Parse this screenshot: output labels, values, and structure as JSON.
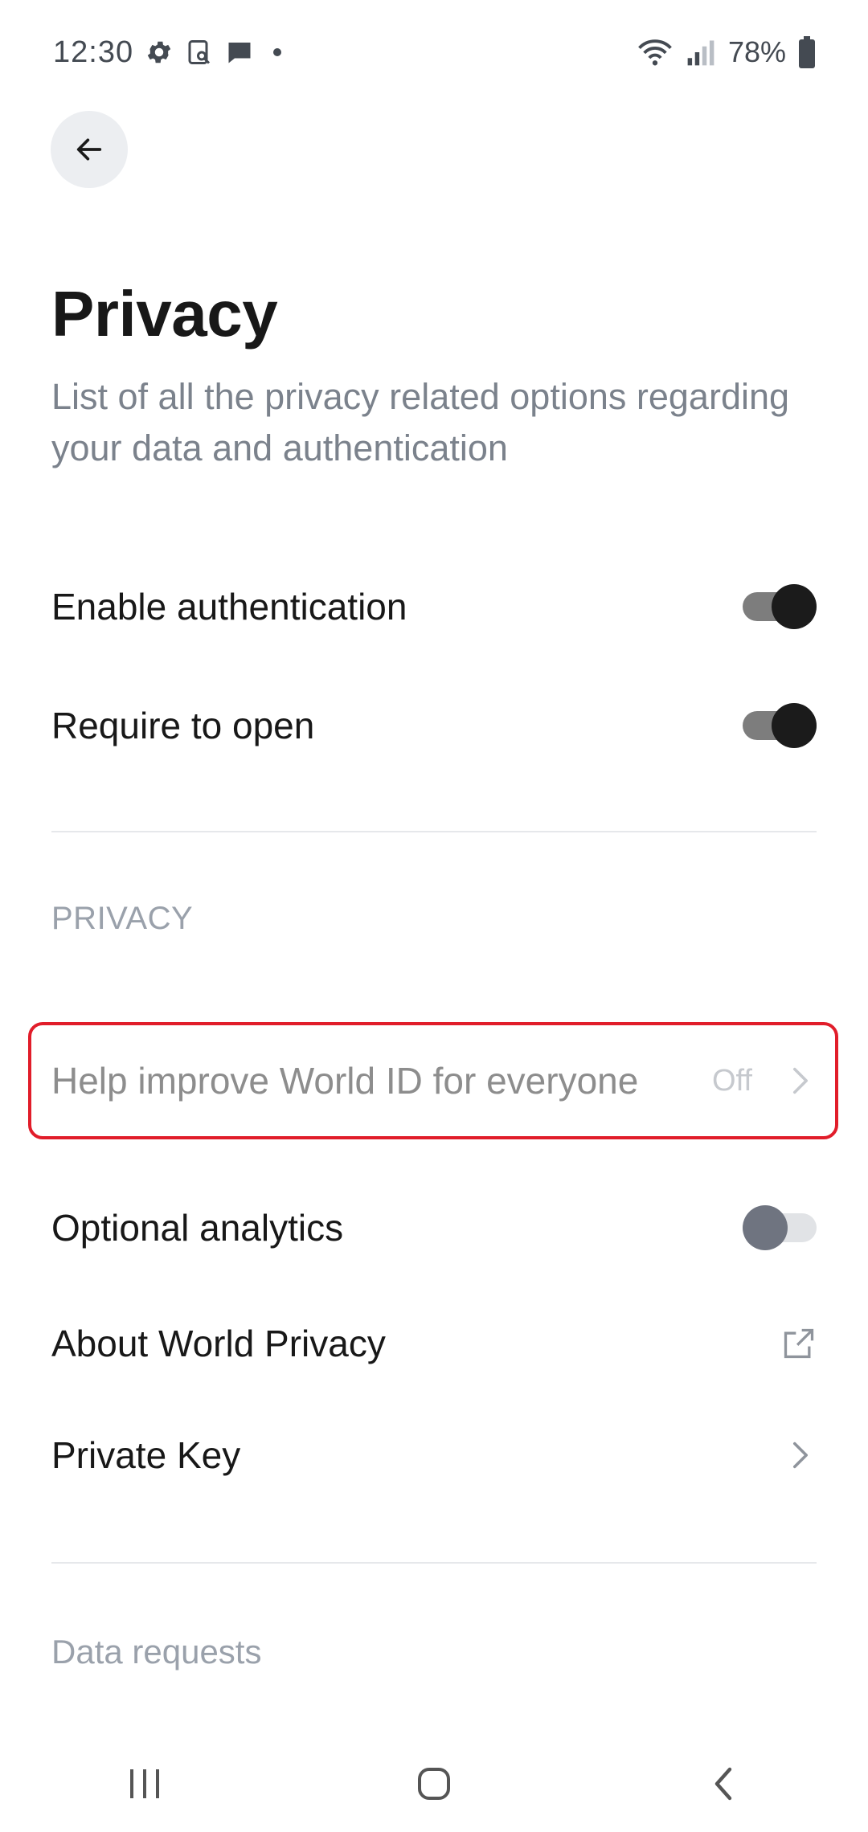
{
  "status_bar": {
    "time": "12:30",
    "battery": "78%",
    "icons": [
      "gear-icon",
      "screenshot-icon",
      "chat-icon",
      "wifi-icon",
      "signal-icon",
      "battery-icon"
    ]
  },
  "header": {
    "title": "Privacy",
    "subtitle": "List of all the privacy related options regarding your data and authentication"
  },
  "auth_settings": [
    {
      "label": "Enable authentication",
      "enabled": true
    },
    {
      "label": "Require to open",
      "enabled": true
    }
  ],
  "privacy_section": {
    "header": "PRIVACY",
    "help_improve": {
      "label": "Help improve World ID for everyone",
      "value": "Off"
    },
    "optional_analytics": {
      "label": "Optional analytics",
      "enabled": false
    },
    "about": {
      "label": "About World Privacy"
    },
    "private_key": {
      "label": "Private Key"
    }
  },
  "data_requests": {
    "header": "Data requests"
  },
  "colors": {
    "highlight": "#e11d2a",
    "toggle_on_knob": "#1b1b1b",
    "toggle_off_knob": "#6f7480",
    "muted_text": "#7b828c"
  }
}
